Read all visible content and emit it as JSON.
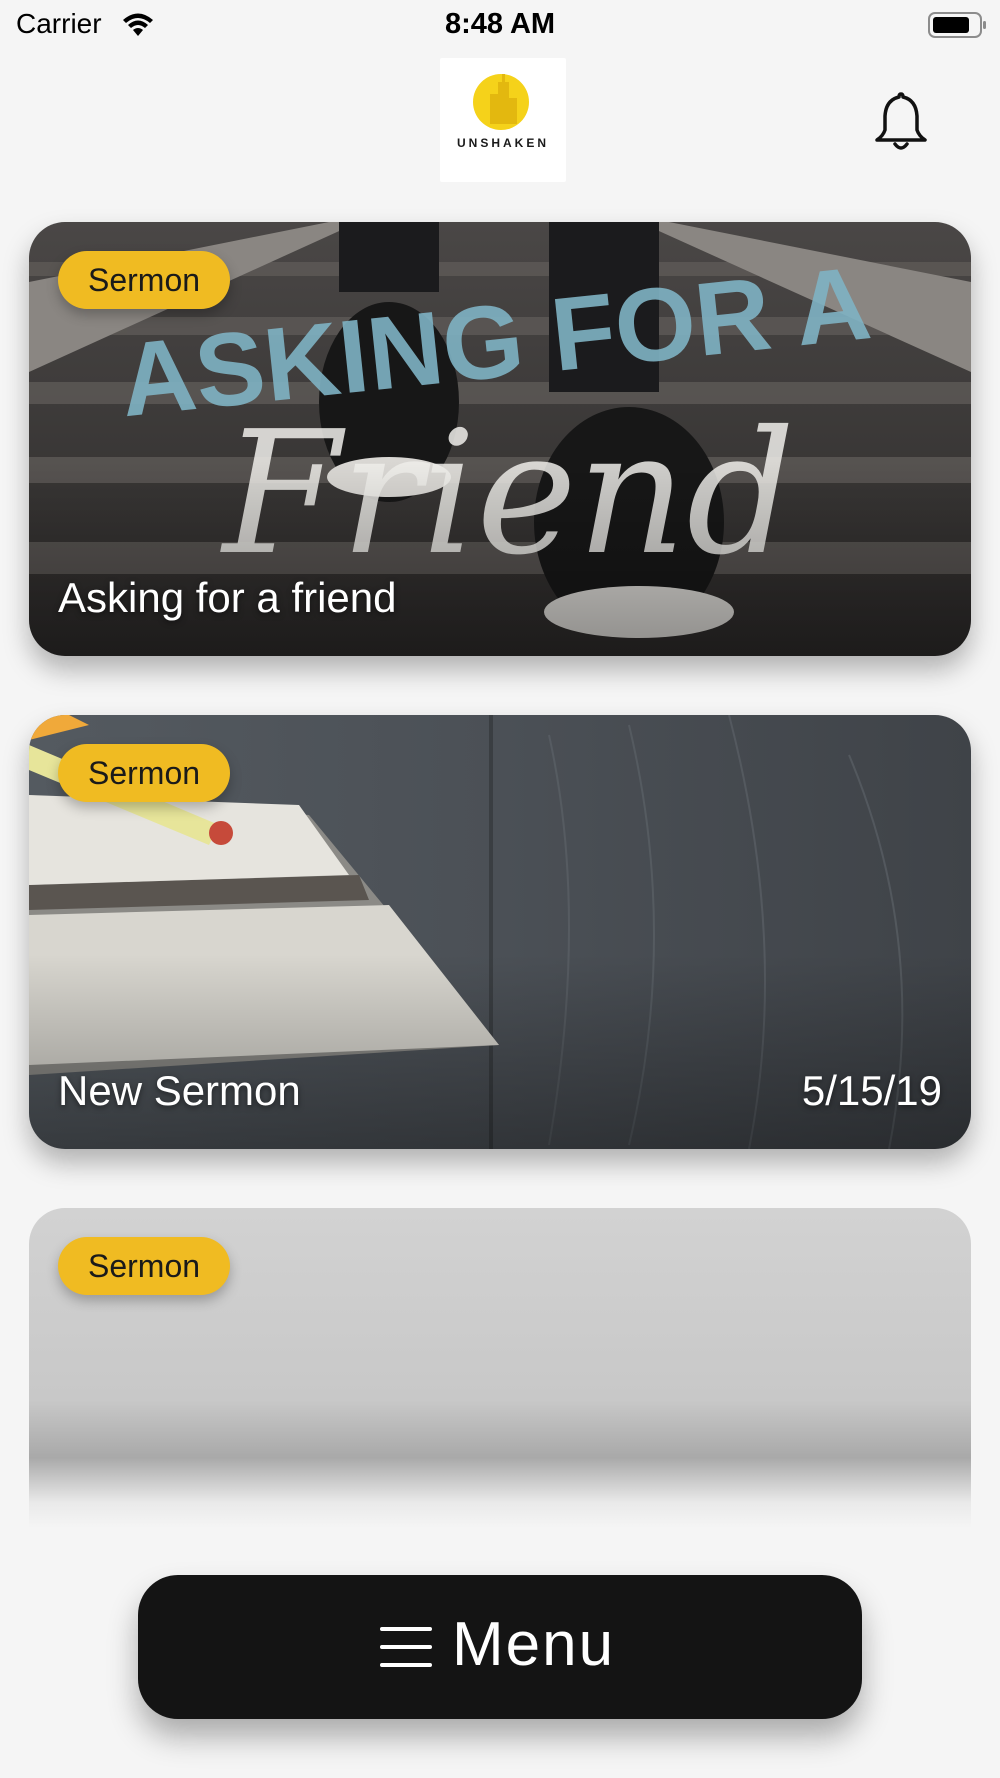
{
  "status_bar": {
    "carrier": "Carrier",
    "time": "8:48 AM"
  },
  "header": {
    "logo_text": "UNSHAKEN",
    "logo_accent": "#f5d21a",
    "notification_icon": "bell-icon"
  },
  "cards": [
    {
      "badge": "Sermon",
      "title": "Asking for a friend",
      "date": "",
      "art_text_top": "ASKING FOR A",
      "art_text_script": "Friend"
    },
    {
      "badge": "Sermon",
      "title": "New Sermon",
      "date": "5/15/19"
    },
    {
      "badge": "Sermon",
      "title": "",
      "date": ""
    }
  ],
  "menu": {
    "label": "Menu",
    "icon": "hamburger-icon",
    "background": "#141414"
  },
  "colors": {
    "badge": "#f0bb22",
    "page_background": "#f5f5f5"
  }
}
